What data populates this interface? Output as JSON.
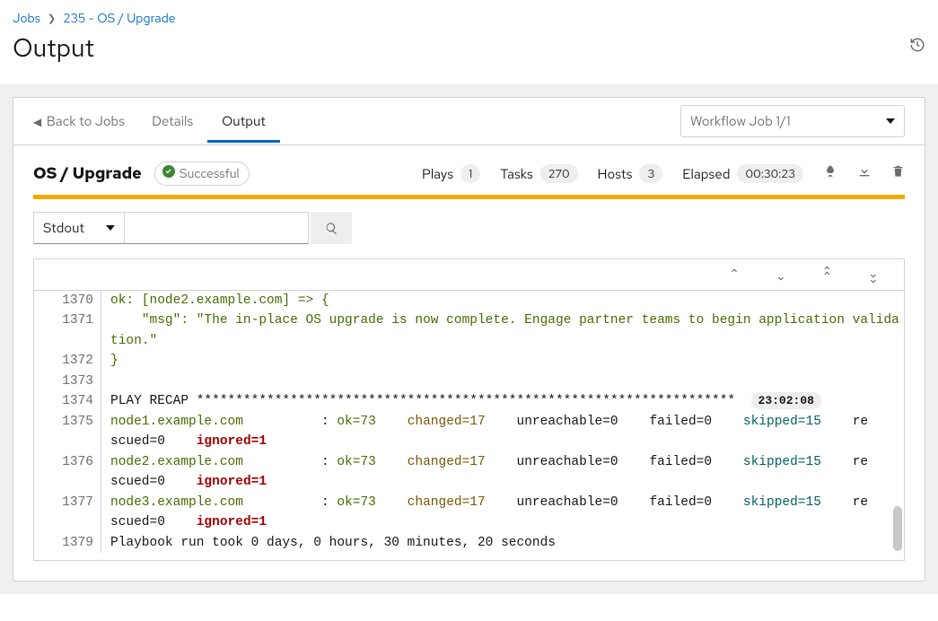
{
  "breadcrumb": {
    "root": "Jobs",
    "item": "235 - OS / Upgrade"
  },
  "page_title": "Output",
  "back_link": "Back to Jobs",
  "tabs": {
    "details": "Details",
    "output": "Output"
  },
  "workflow_select": "Workflow Job 1/1",
  "job": {
    "title": "OS / Upgrade",
    "status_label": "Successful",
    "plays_label": "Plays",
    "plays_count": "1",
    "tasks_label": "Tasks",
    "tasks_count": "270",
    "hosts_label": "Hosts",
    "hosts_count": "3",
    "elapsed_label": "Elapsed",
    "elapsed_value": "00:30:23"
  },
  "filter_label": "Stdout",
  "log": {
    "l1370": "ok: [node2.example.com] => {",
    "l1371": "    \"msg\": \"The in-place OS upgrade is now complete. Engage partner teams to begin application validation.\"",
    "l1372": "}",
    "l1374_pre": "PLAY RECAP *********************************************************************",
    "l1374_ts": "23:02:08",
    "recap": [
      {
        "ln": "1375",
        "host": "node1.example.com",
        "ok": "ok=73",
        "changed": "changed=17",
        "unreach": "unreachable=0",
        "failed": "failed=0",
        "skipped": "skipped=15",
        "rescued": "rescued=0",
        "ignored": "ignored=1"
      },
      {
        "ln": "1376",
        "host": "node2.example.com",
        "ok": "ok=73",
        "changed": "changed=17",
        "unreach": "unreachable=0",
        "failed": "failed=0",
        "skipped": "skipped=15",
        "rescued": "rescued=0",
        "ignored": "ignored=1"
      },
      {
        "ln": "1377",
        "host": "node3.example.com",
        "ok": "ok=73",
        "changed": "changed=17",
        "unreach": "unreachable=0",
        "failed": "failed=0",
        "skipped": "skipped=15",
        "rescued": "rescued=0",
        "ignored": "ignored=1"
      }
    ],
    "l1379": "Playbook run took 0 days, 0 hours, 30 minutes, 20 seconds"
  }
}
